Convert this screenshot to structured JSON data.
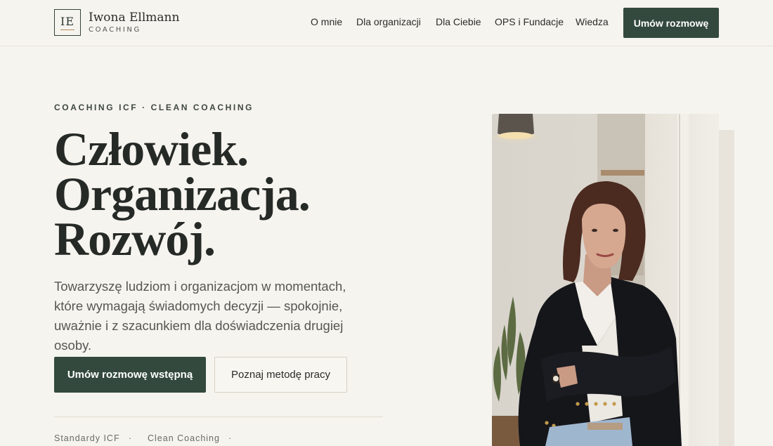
{
  "header": {
    "logo": {
      "monogram": "IE",
      "name": "Iwona Ellmann",
      "tagline": "COACHING"
    },
    "nav": [
      {
        "label": "O mnie"
      },
      {
        "label": "Dla organizacji"
      },
      {
        "label": "Dla Ciebie"
      },
      {
        "label": "OPS i Fundacje"
      },
      {
        "label": "Wiedza"
      }
    ],
    "cta_label": "Umów rozmowę"
  },
  "hero": {
    "eyebrow": "COACHING ICF · CLEAN COACHING",
    "headline": [
      "Człowiek.",
      "Organizacja.",
      "Rozwój."
    ],
    "lead": "Towarzyszę ludziom i organizacjom w momentach, które wymagają świadomych decyzji — spokojnie, uważnie i z szacunkiem dla doświadczenia drugiej osoby.",
    "primary_button": "Umów rozmowę wstępną",
    "secondary_button": "Poznaj metodę pracy",
    "standards": [
      "Standardy ICF",
      "·",
      "Clean Coaching",
      "·"
    ]
  },
  "colors": {
    "background": "#f6f4ef",
    "accent": "#33493d",
    "text": "#2b2b29",
    "logo_rule": "#b58a55"
  }
}
